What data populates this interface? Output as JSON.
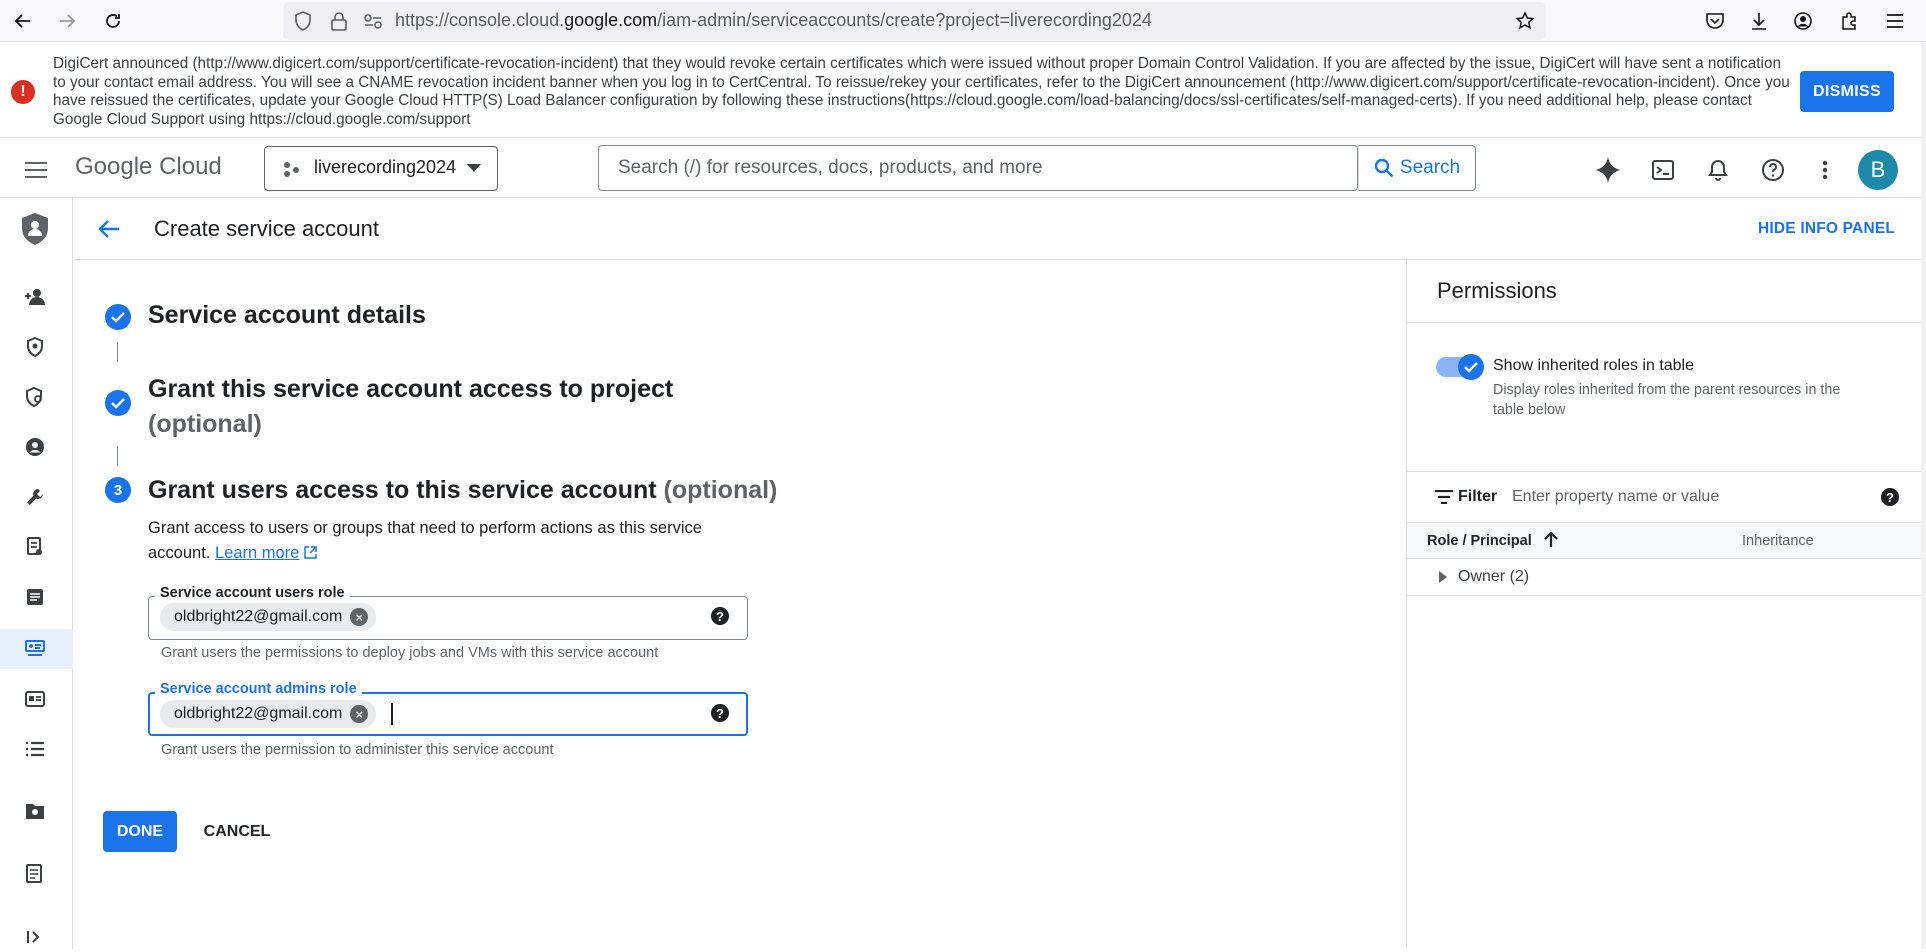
{
  "browser": {
    "url_prefix": "https://console.cloud.",
    "url_domain": "google.com",
    "url_path": "/iam-admin/serviceaccounts/create?project=liverecording2024"
  },
  "banner": {
    "text": "DigiCert announced (http://www.digicert.com/support/certificate-revocation-incident) that they would revoke certain certificates which were issued without proper Domain Control Validation. If you are affected by the issue, DigiCert will have sent a notification to your contact email address. You will see a CNAME revocation incident banner when you log in to CertCentral. To reissue/rekey your certificates, refer to the DigiCert announcement (http://www.digicert.com/support/certificate-revocation-incident). Once you have reissued the certificates, update your Google Cloud HTTP(S) Load Balancer configuration by following these instructions(https://cloud.google.com/load-balancing/docs/ssl-certificates/self-managed-certs). If you need additional help, please contact Google Cloud Support using https://cloud.google.com/support",
    "dismiss_label": "DISMISS"
  },
  "header": {
    "logo_google": "Google",
    "logo_cloud": "Cloud",
    "project_name": "liverecording2024",
    "search_placeholder": "Search (/) for resources, docs, products, and more",
    "search_button": "Search",
    "avatar_letter": "B"
  },
  "page": {
    "title": "Create service account",
    "hide_info_panel": "HIDE INFO PANEL"
  },
  "steps": {
    "step1_title": "Service account details",
    "step2_title": "Grant this service account access to project",
    "step2_optional": "(optional)",
    "step3_number": "3",
    "step3_title": "Grant users access to this service account",
    "step3_optional": "(optional)",
    "step3_desc": "Grant access to users or groups that need to perform actions as this service account.",
    "learn_more": "Learn more"
  },
  "fields": {
    "users_role": {
      "label": "Service account users role",
      "chip": "oldbright22@gmail.com",
      "hint": "Grant users the permissions to deploy jobs and VMs with this service account"
    },
    "admins_role": {
      "label": "Service account admins role",
      "chip": "oldbright22@gmail.com",
      "hint": "Grant users the permission to administer this service account"
    }
  },
  "actions": {
    "done": "DONE",
    "cancel": "CANCEL"
  },
  "info_panel": {
    "title": "Permissions",
    "toggle_label": "Show inherited roles in table",
    "toggle_on": true,
    "toggle_sub": "Display roles inherited from the parent resources in the table below",
    "filter_label": "Filter",
    "filter_placeholder": "Enter property name or value",
    "col_role": "Role / Principal",
    "col_inheritance": "Inheritance",
    "rows": [
      {
        "label": "Owner (2)"
      }
    ]
  },
  "colors": {
    "accent": "#1a73e8",
    "banner_error": "#d93025"
  }
}
